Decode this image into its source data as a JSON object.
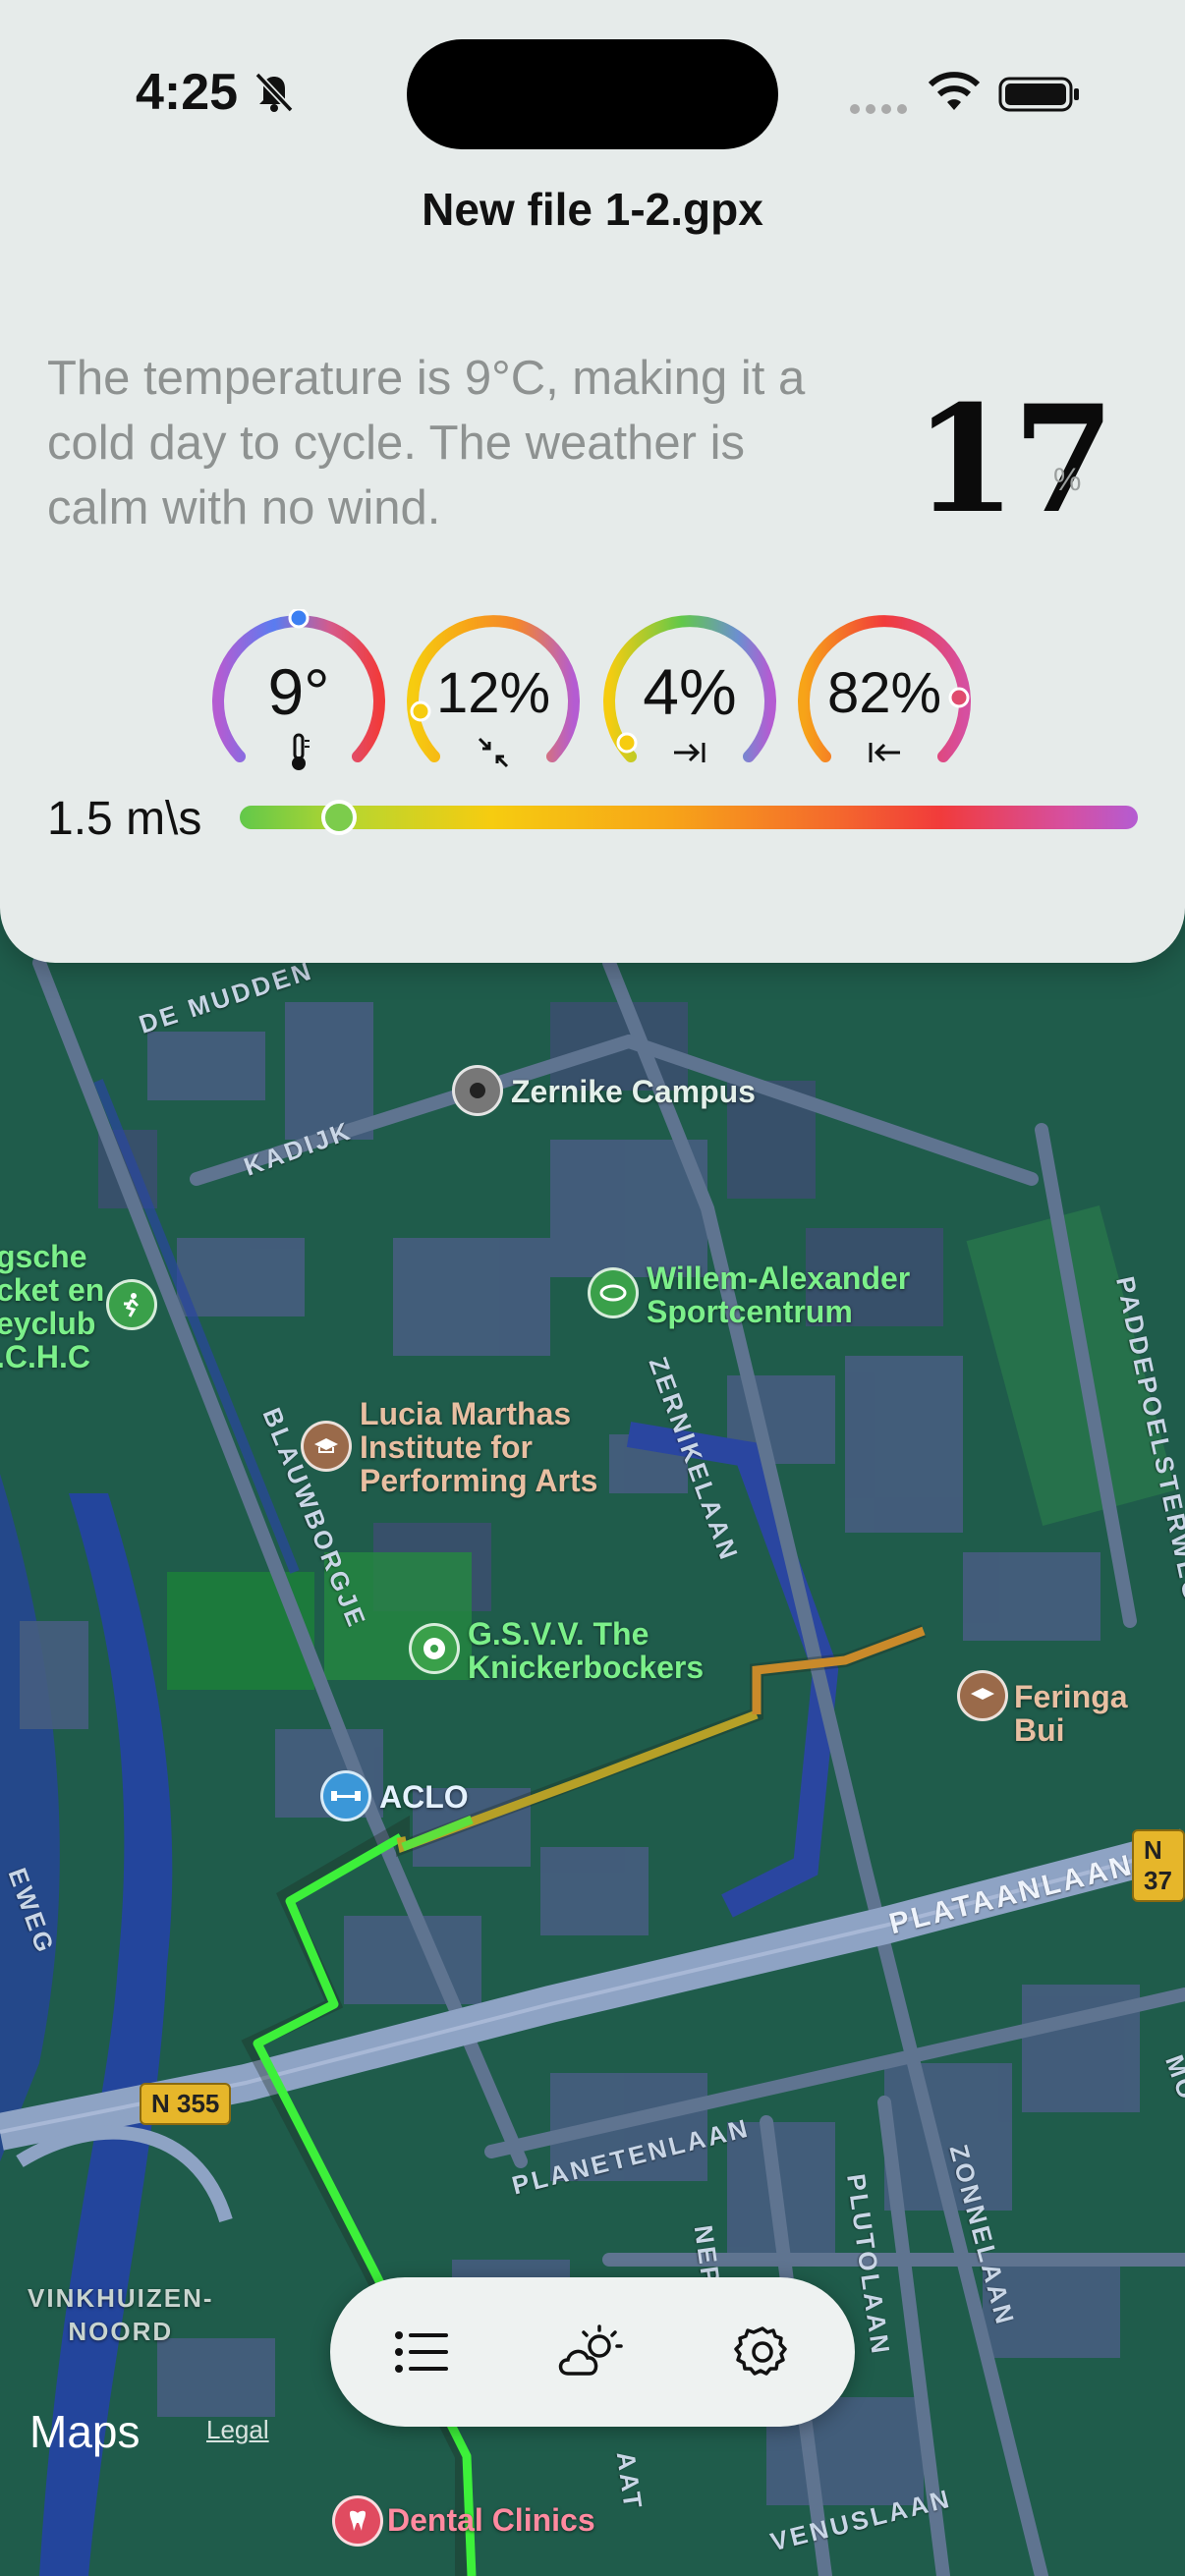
{
  "status_bar": {
    "time": "4:25"
  },
  "header": {
    "file_name": "New file 1-2.gpx"
  },
  "summary": {
    "description": "The temperature is 9°C, making it a cold day to cycle. The weather is calm with no wind.",
    "score": "17",
    "score_unit": "%"
  },
  "gauges": [
    {
      "value": "9°",
      "icon": "thermometer-icon"
    },
    {
      "value": "12%",
      "icon": "arrows-inward-icon"
    },
    {
      "value": "4%",
      "icon": "arrow-right-to-bar-icon"
    },
    {
      "value": "82%",
      "icon": "arrow-left-to-bar-icon"
    }
  ],
  "wind": {
    "speed_label": "1.5 m\\s",
    "level_fraction": 0.11
  },
  "map": {
    "places": [
      "Zernike Campus",
      "Willem-Alexander\nSportcentrum",
      "Lucia Marthas\nInstitute for\nPerforming Arts",
      "G.S.V.V. The\nKnickerbockers",
      "Feringa Bui",
      "ACLO",
      "gsche\ncket en\neyclub\n.C.H.C",
      "Dental Clinics",
      "VINKHUIZEN-\nNOORD"
    ],
    "roads": [
      "DE MUDDEN",
      "KADIJK",
      "BLAUWBORGJE",
      "ZERNIKELAAN",
      "PADDEPOELSTERWEG",
      "PLATAANLAAN",
      "PLANETENLAAN",
      "NEPT",
      "PLUTOLAAN",
      "ZONNELAAN",
      "VENUSLAAN",
      "AAT",
      "EWEG",
      "MO"
    ],
    "shields": [
      "N 355",
      "N 37"
    ]
  },
  "toolbar": {
    "icons": [
      "list-icon",
      "weather-icon",
      "settings-icon"
    ]
  },
  "attribution": {
    "maps": "Maps",
    "legal": "Legal"
  }
}
